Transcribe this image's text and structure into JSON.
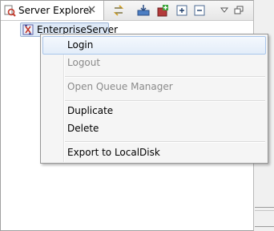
{
  "view": {
    "tab_title": "Server Explorer",
    "tab_icon": "server-explorer-icon",
    "toolbar": [
      {
        "name": "sync-icon"
      },
      {
        "name": "import-icon"
      },
      {
        "name": "add-server-icon"
      },
      {
        "name": "expand-all-icon"
      },
      {
        "name": "collapse-all-icon"
      }
    ],
    "menu_icon": "view-menu-icon",
    "minimize_icon": "minimize-icon"
  },
  "tree": {
    "items": [
      {
        "label": "EnterpriseServer",
        "icon": "enterprise-server-icon",
        "selected": true
      }
    ]
  },
  "context_menu": {
    "items": [
      {
        "label": "Login",
        "enabled": true,
        "highlighted": true
      },
      {
        "label": "Logout",
        "enabled": false
      },
      {
        "label": "Open Queue Manager",
        "enabled": false
      },
      {
        "label": "Duplicate",
        "enabled": true
      },
      {
        "label": "Delete",
        "enabled": true
      },
      {
        "label": "Export to LocalDisk",
        "enabled": true
      }
    ]
  },
  "colors": {
    "selection_bg": "#dde8f6",
    "highlight_border": "#a9c6ec",
    "disabled_text": "#8a8a8a"
  }
}
